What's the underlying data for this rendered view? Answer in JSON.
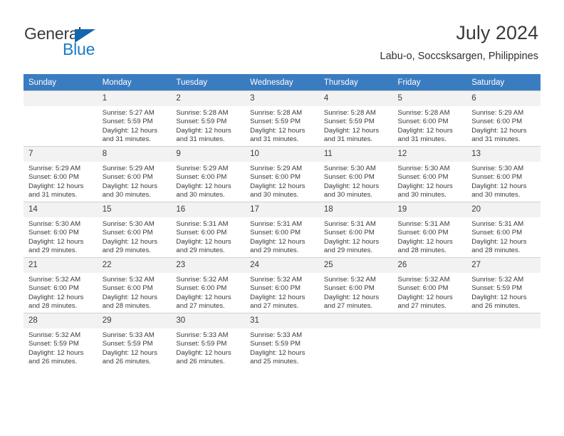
{
  "brand": {
    "name_part1": "General",
    "name_part2": "Blue",
    "flag_icon": "flag-icon",
    "accent_color": "#1267b1"
  },
  "header": {
    "title": "July 2024",
    "subtitle": "Labu-o, Soccsksargen, Philippines"
  },
  "calendar": {
    "header_bg": "#3a7cc0",
    "daynum_bg": "#f2f2f2",
    "weekdays": [
      "Sunday",
      "Monday",
      "Tuesday",
      "Wednesday",
      "Thursday",
      "Friday",
      "Saturday"
    ],
    "weeks": [
      [
        {
          "day": "",
          "sunrise": "",
          "sunset": "",
          "daylight_line1": "",
          "daylight_line2": "",
          "empty": true
        },
        {
          "day": "1",
          "sunrise": "Sunrise: 5:27 AM",
          "sunset": "Sunset: 5:59 PM",
          "daylight_line1": "Daylight: 12 hours",
          "daylight_line2": "and 31 minutes.",
          "empty": false
        },
        {
          "day": "2",
          "sunrise": "Sunrise: 5:28 AM",
          "sunset": "Sunset: 5:59 PM",
          "daylight_line1": "Daylight: 12 hours",
          "daylight_line2": "and 31 minutes.",
          "empty": false
        },
        {
          "day": "3",
          "sunrise": "Sunrise: 5:28 AM",
          "sunset": "Sunset: 5:59 PM",
          "daylight_line1": "Daylight: 12 hours",
          "daylight_line2": "and 31 minutes.",
          "empty": false
        },
        {
          "day": "4",
          "sunrise": "Sunrise: 5:28 AM",
          "sunset": "Sunset: 5:59 PM",
          "daylight_line1": "Daylight: 12 hours",
          "daylight_line2": "and 31 minutes.",
          "empty": false
        },
        {
          "day": "5",
          "sunrise": "Sunrise: 5:28 AM",
          "sunset": "Sunset: 6:00 PM",
          "daylight_line1": "Daylight: 12 hours",
          "daylight_line2": "and 31 minutes.",
          "empty": false
        },
        {
          "day": "6",
          "sunrise": "Sunrise: 5:29 AM",
          "sunset": "Sunset: 6:00 PM",
          "daylight_line1": "Daylight: 12 hours",
          "daylight_line2": "and 31 minutes.",
          "empty": false
        }
      ],
      [
        {
          "day": "7",
          "sunrise": "Sunrise: 5:29 AM",
          "sunset": "Sunset: 6:00 PM",
          "daylight_line1": "Daylight: 12 hours",
          "daylight_line2": "and 31 minutes.",
          "empty": false
        },
        {
          "day": "8",
          "sunrise": "Sunrise: 5:29 AM",
          "sunset": "Sunset: 6:00 PM",
          "daylight_line1": "Daylight: 12 hours",
          "daylight_line2": "and 30 minutes.",
          "empty": false
        },
        {
          "day": "9",
          "sunrise": "Sunrise: 5:29 AM",
          "sunset": "Sunset: 6:00 PM",
          "daylight_line1": "Daylight: 12 hours",
          "daylight_line2": "and 30 minutes.",
          "empty": false
        },
        {
          "day": "10",
          "sunrise": "Sunrise: 5:29 AM",
          "sunset": "Sunset: 6:00 PM",
          "daylight_line1": "Daylight: 12 hours",
          "daylight_line2": "and 30 minutes.",
          "empty": false
        },
        {
          "day": "11",
          "sunrise": "Sunrise: 5:30 AM",
          "sunset": "Sunset: 6:00 PM",
          "daylight_line1": "Daylight: 12 hours",
          "daylight_line2": "and 30 minutes.",
          "empty": false
        },
        {
          "day": "12",
          "sunrise": "Sunrise: 5:30 AM",
          "sunset": "Sunset: 6:00 PM",
          "daylight_line1": "Daylight: 12 hours",
          "daylight_line2": "and 30 minutes.",
          "empty": false
        },
        {
          "day": "13",
          "sunrise": "Sunrise: 5:30 AM",
          "sunset": "Sunset: 6:00 PM",
          "daylight_line1": "Daylight: 12 hours",
          "daylight_line2": "and 30 minutes.",
          "empty": false
        }
      ],
      [
        {
          "day": "14",
          "sunrise": "Sunrise: 5:30 AM",
          "sunset": "Sunset: 6:00 PM",
          "daylight_line1": "Daylight: 12 hours",
          "daylight_line2": "and 29 minutes.",
          "empty": false
        },
        {
          "day": "15",
          "sunrise": "Sunrise: 5:30 AM",
          "sunset": "Sunset: 6:00 PM",
          "daylight_line1": "Daylight: 12 hours",
          "daylight_line2": "and 29 minutes.",
          "empty": false
        },
        {
          "day": "16",
          "sunrise": "Sunrise: 5:31 AM",
          "sunset": "Sunset: 6:00 PM",
          "daylight_line1": "Daylight: 12 hours",
          "daylight_line2": "and 29 minutes.",
          "empty": false
        },
        {
          "day": "17",
          "sunrise": "Sunrise: 5:31 AM",
          "sunset": "Sunset: 6:00 PM",
          "daylight_line1": "Daylight: 12 hours",
          "daylight_line2": "and 29 minutes.",
          "empty": false
        },
        {
          "day": "18",
          "sunrise": "Sunrise: 5:31 AM",
          "sunset": "Sunset: 6:00 PM",
          "daylight_line1": "Daylight: 12 hours",
          "daylight_line2": "and 29 minutes.",
          "empty": false
        },
        {
          "day": "19",
          "sunrise": "Sunrise: 5:31 AM",
          "sunset": "Sunset: 6:00 PM",
          "daylight_line1": "Daylight: 12 hours",
          "daylight_line2": "and 28 minutes.",
          "empty": false
        },
        {
          "day": "20",
          "sunrise": "Sunrise: 5:31 AM",
          "sunset": "Sunset: 6:00 PM",
          "daylight_line1": "Daylight: 12 hours",
          "daylight_line2": "and 28 minutes.",
          "empty": false
        }
      ],
      [
        {
          "day": "21",
          "sunrise": "Sunrise: 5:32 AM",
          "sunset": "Sunset: 6:00 PM",
          "daylight_line1": "Daylight: 12 hours",
          "daylight_line2": "and 28 minutes.",
          "empty": false
        },
        {
          "day": "22",
          "sunrise": "Sunrise: 5:32 AM",
          "sunset": "Sunset: 6:00 PM",
          "daylight_line1": "Daylight: 12 hours",
          "daylight_line2": "and 28 minutes.",
          "empty": false
        },
        {
          "day": "23",
          "sunrise": "Sunrise: 5:32 AM",
          "sunset": "Sunset: 6:00 PM",
          "daylight_line1": "Daylight: 12 hours",
          "daylight_line2": "and 27 minutes.",
          "empty": false
        },
        {
          "day": "24",
          "sunrise": "Sunrise: 5:32 AM",
          "sunset": "Sunset: 6:00 PM",
          "daylight_line1": "Daylight: 12 hours",
          "daylight_line2": "and 27 minutes.",
          "empty": false
        },
        {
          "day": "25",
          "sunrise": "Sunrise: 5:32 AM",
          "sunset": "Sunset: 6:00 PM",
          "daylight_line1": "Daylight: 12 hours",
          "daylight_line2": "and 27 minutes.",
          "empty": false
        },
        {
          "day": "26",
          "sunrise": "Sunrise: 5:32 AM",
          "sunset": "Sunset: 6:00 PM",
          "daylight_line1": "Daylight: 12 hours",
          "daylight_line2": "and 27 minutes.",
          "empty": false
        },
        {
          "day": "27",
          "sunrise": "Sunrise: 5:32 AM",
          "sunset": "Sunset: 5:59 PM",
          "daylight_line1": "Daylight: 12 hours",
          "daylight_line2": "and 26 minutes.",
          "empty": false
        }
      ],
      [
        {
          "day": "28",
          "sunrise": "Sunrise: 5:32 AM",
          "sunset": "Sunset: 5:59 PM",
          "daylight_line1": "Daylight: 12 hours",
          "daylight_line2": "and 26 minutes.",
          "empty": false
        },
        {
          "day": "29",
          "sunrise": "Sunrise: 5:33 AM",
          "sunset": "Sunset: 5:59 PM",
          "daylight_line1": "Daylight: 12 hours",
          "daylight_line2": "and 26 minutes.",
          "empty": false
        },
        {
          "day": "30",
          "sunrise": "Sunrise: 5:33 AM",
          "sunset": "Sunset: 5:59 PM",
          "daylight_line1": "Daylight: 12 hours",
          "daylight_line2": "and 26 minutes.",
          "empty": false
        },
        {
          "day": "31",
          "sunrise": "Sunrise: 5:33 AM",
          "sunset": "Sunset: 5:59 PM",
          "daylight_line1": "Daylight: 12 hours",
          "daylight_line2": "and 25 minutes.",
          "empty": false
        },
        {
          "day": "",
          "sunrise": "",
          "sunset": "",
          "daylight_line1": "",
          "daylight_line2": "",
          "empty": true
        },
        {
          "day": "",
          "sunrise": "",
          "sunset": "",
          "daylight_line1": "",
          "daylight_line2": "",
          "empty": true
        },
        {
          "day": "",
          "sunrise": "",
          "sunset": "",
          "daylight_line1": "",
          "daylight_line2": "",
          "empty": true
        }
      ]
    ]
  }
}
